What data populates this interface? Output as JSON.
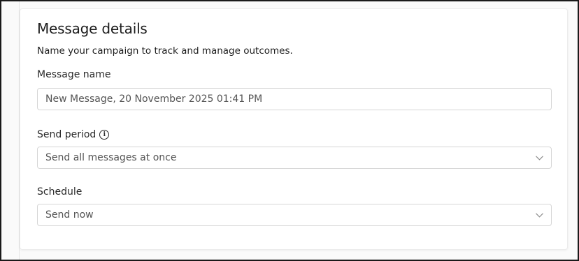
{
  "card": {
    "title": "Message details",
    "subtitle": "Name your campaign to track and manage outcomes."
  },
  "message_name": {
    "label": "Message name",
    "value": "New Message, 20 November 2025 01:41 PM"
  },
  "send_period": {
    "label": "Send period",
    "info_icon": "info-icon",
    "selected": "Send all messages at once"
  },
  "schedule": {
    "label": "Schedule",
    "selected": "Send now"
  },
  "colors": {
    "border": "#d6d6d6",
    "text": "#1c1c1c",
    "muted": "#555555"
  }
}
